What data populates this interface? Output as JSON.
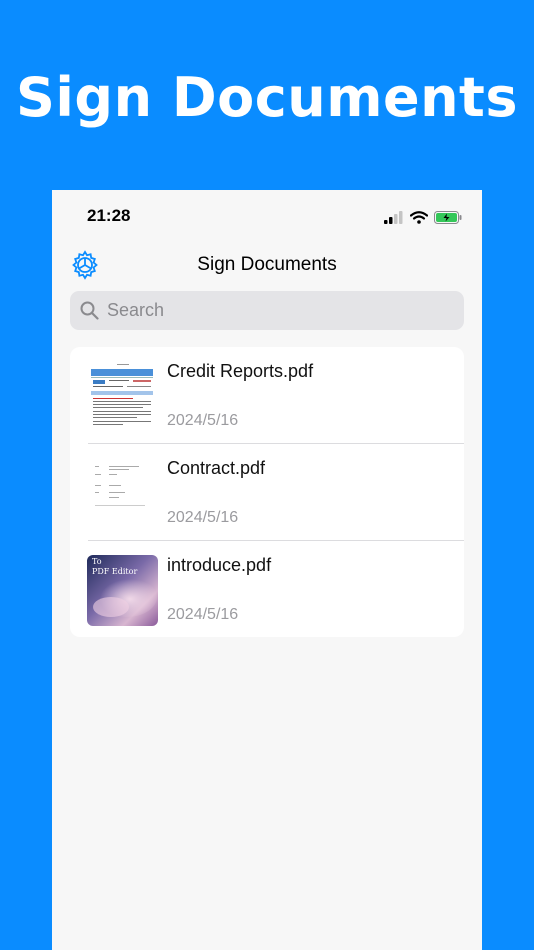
{
  "banner": {
    "title": "Sign Documents"
  },
  "status_bar": {
    "time": "21:28"
  },
  "nav": {
    "title": "Sign Documents"
  },
  "search": {
    "placeholder": "Search"
  },
  "files": [
    {
      "name": "Credit Reports.pdf",
      "date": "2024/5/16"
    },
    {
      "name": "Contract.pdf",
      "date": "2024/5/16"
    },
    {
      "name": "introduce.pdf",
      "date": "2024/5/16",
      "thumb_text_1": "To",
      "thumb_text_2": "PDF Editor"
    }
  ],
  "colors": {
    "accent": "#0a8cff",
    "battery": "#34c759"
  }
}
